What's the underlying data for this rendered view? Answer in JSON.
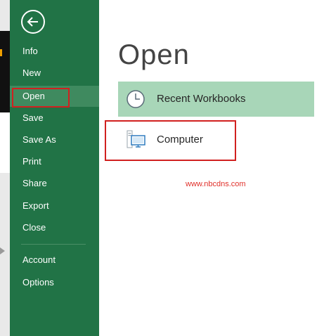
{
  "sidebar": {
    "items": [
      {
        "label": "Info"
      },
      {
        "label": "New"
      },
      {
        "label": "Open"
      },
      {
        "label": "Save"
      },
      {
        "label": "Save As"
      },
      {
        "label": "Print"
      },
      {
        "label": "Share"
      },
      {
        "label": "Export"
      },
      {
        "label": "Close"
      },
      {
        "label": "Account"
      },
      {
        "label": "Options"
      }
    ],
    "selected": "Open"
  },
  "main": {
    "title": "Open",
    "locations": [
      {
        "label": "Recent Workbooks",
        "icon": "clock-icon"
      },
      {
        "label": "Computer",
        "icon": "computer-icon"
      }
    ]
  },
  "watermark": "www.nbcdns.com",
  "colors": {
    "sidebar": "#217346",
    "selected": "#3f8a5f",
    "recent_bg": "#a8d6b8",
    "highlight": "#d1201f"
  }
}
